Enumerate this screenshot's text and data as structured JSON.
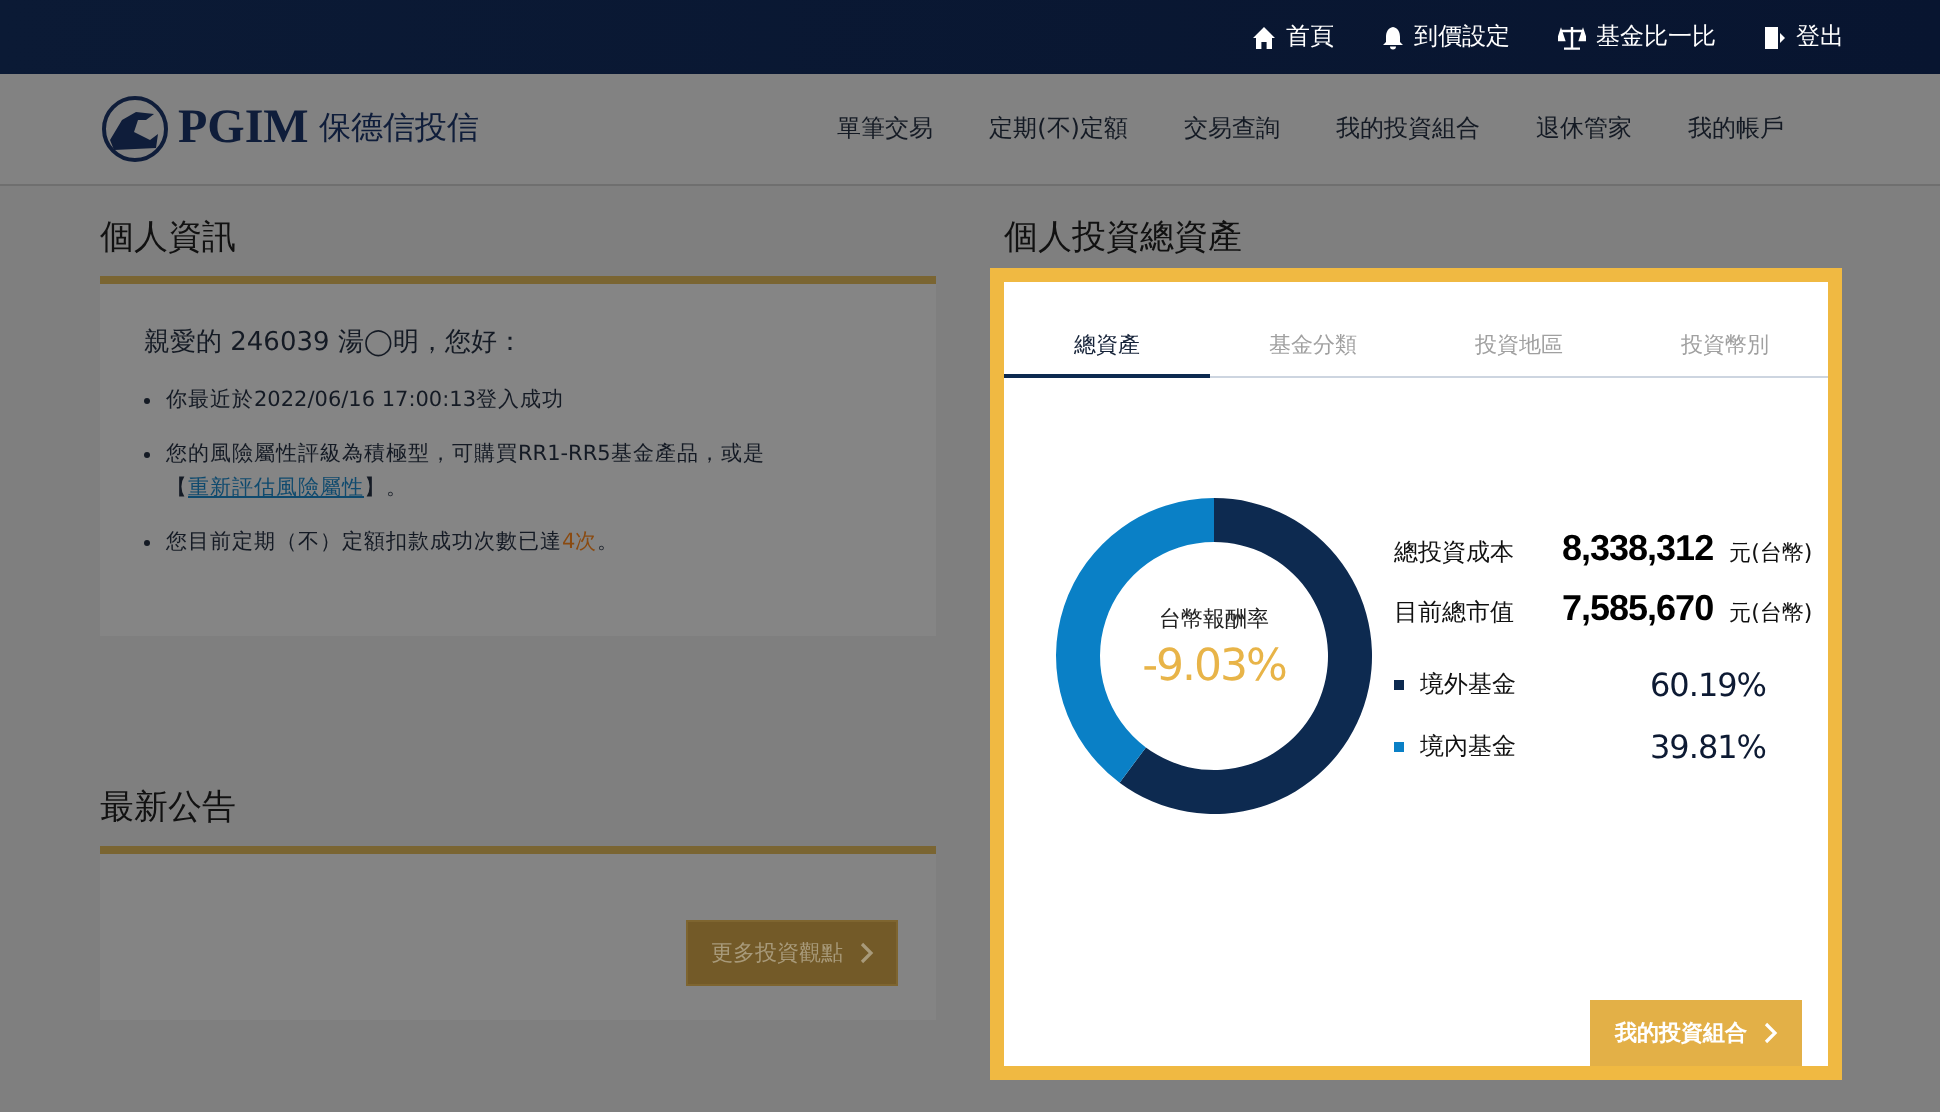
{
  "top_bar": {
    "links": [
      {
        "label": "首頁"
      },
      {
        "label": "到價設定"
      },
      {
        "label": "基金比一比"
      },
      {
        "label": "登出"
      }
    ]
  },
  "header": {
    "logo_text": "PGIM",
    "logo_subtitle": "保德信投信",
    "nav": [
      "單筆交易",
      "定期(不)定額",
      "交易查詢",
      "我的投資組合",
      "退休管家",
      "我的帳戶"
    ]
  },
  "personal_info": {
    "title": "個人資訊",
    "greeting": "親愛的 246039 湯◯明，您好：",
    "items": [
      {
        "parts": [
          {
            "kind": "text",
            "text": "你最近於2022/06/16 17:00:13登入成功"
          }
        ]
      },
      {
        "parts": [
          {
            "kind": "text",
            "text": "您的風險屬性評級為積極型，可購買RR1-RR5基金產品，或是【"
          },
          {
            "kind": "link",
            "text": "重新評估風險屬性"
          },
          {
            "kind": "text",
            "text": "】。"
          }
        ]
      },
      {
        "parts": [
          {
            "kind": "text",
            "text": "您目前定期（不）定額扣款成功次數已達"
          },
          {
            "kind": "highlight",
            "text": "4次"
          },
          {
            "kind": "text",
            "text": "。"
          }
        ]
      }
    ]
  },
  "announcements": {
    "title": "最新公告",
    "button": "更多投資觀點"
  },
  "assets": {
    "title": "個人投資總資產",
    "tabs": [
      {
        "label": "總資產",
        "selected": true
      },
      {
        "label": "基金分類",
        "selected": false
      },
      {
        "label": "投資地區",
        "selected": false
      },
      {
        "label": "投資幣別",
        "selected": false
      }
    ],
    "chart_data": {
      "type": "donut",
      "categories": [
        "境外基金",
        "境內基金"
      ],
      "values": [
        60.19,
        39.81
      ]
    },
    "return_label": "台幣報酬率",
    "return_value": "-9.03%",
    "stats": [
      {
        "label": "總投資成本",
        "value": "8,338,312",
        "unit": "元(台幣)"
      },
      {
        "label": "目前總市值",
        "value": "7,585,670",
        "unit": "元(台幣)"
      }
    ],
    "legend": [
      {
        "value": "60.19%",
        "color": "#0d2a50"
      },
      {
        "value": "39.81%",
        "color": "#0a80c6"
      }
    ],
    "button": "我的投資組合"
  }
}
